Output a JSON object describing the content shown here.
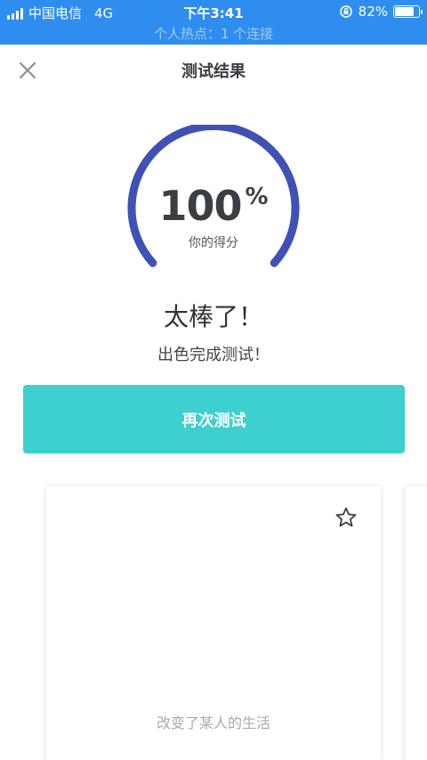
{
  "status_bar": {
    "carrier": "中国电信",
    "network": "4G",
    "time": "下午3:41",
    "battery_percent": "82%",
    "battery_level": 0.82
  },
  "hotspot_text": "个人热点：1 个连接",
  "header": {
    "title": "测试结果",
    "close_icon": "close-icon"
  },
  "result": {
    "score": "100",
    "score_unit": "%",
    "score_label": "你的得分",
    "gauge_fraction": 1.0,
    "headline": "太棒了！",
    "subline": "出色完成测试！"
  },
  "retry_button": {
    "label": "再次测试"
  },
  "card": {
    "caption": "改变了某人的生活",
    "star_icon": "star-outline-icon"
  },
  "colors": {
    "status_bar": "#2f8df0",
    "gauge": "#3f51b5",
    "button": "#3ecfcf",
    "title_text": "#3a3f44"
  }
}
